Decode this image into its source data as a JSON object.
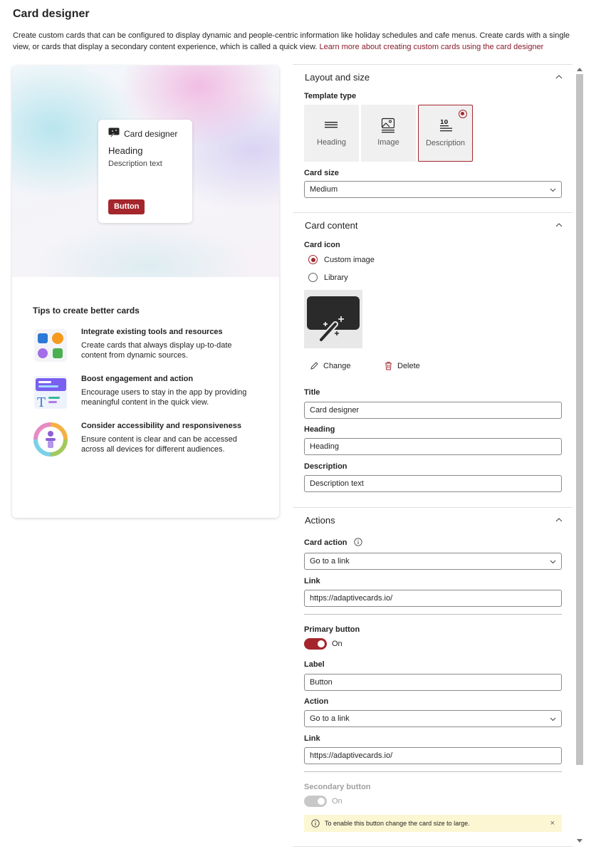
{
  "header": {
    "title": "Card designer",
    "description": "Create custom cards that can be configured to display dynamic and people-centric information like holiday schedules and cafe menus. Create cards with a single view, or cards that display a secondary content experience, which is called a quick view. ",
    "learn_more": "Learn more about creating custom cards using the card designer"
  },
  "preview": {
    "card_title": "Card designer",
    "heading": "Heading",
    "description": "Description text",
    "button": "Button"
  },
  "tips": {
    "title": "Tips to create better cards",
    "items": [
      {
        "title": "Integrate existing tools and resources",
        "text": "Create cards that always display up-to-date content from dynamic sources."
      },
      {
        "title": "Boost engagement and action",
        "text": "Encourage users to stay in the app by providing meaningful content in the quick view."
      },
      {
        "title": "Consider accessibility and responsiveness",
        "text": "Ensure content is clear and can be accessed across all devices for different audiences."
      }
    ]
  },
  "layout": {
    "section_title": "Layout and size",
    "template_type_label": "Template type",
    "templates": [
      "Heading",
      "Image",
      "Description"
    ],
    "selected_template": "Description",
    "card_size_label": "Card size",
    "card_size_value": "Medium"
  },
  "content": {
    "section_title": "Card content",
    "card_icon_label": "Card icon",
    "icon_options": [
      "Custom image",
      "Library"
    ],
    "selected_icon_option": "Custom image",
    "change_label": "Change",
    "delete_label": "Delete",
    "title_label": "Title",
    "title_value": "Card designer",
    "heading_label": "Heading",
    "heading_value": "Heading",
    "description_label": "Description",
    "description_value": "Description text"
  },
  "actions": {
    "section_title": "Actions",
    "card_action_label": "Card action",
    "card_action_value": "Go to a link",
    "link_label": "Link",
    "link_value": "https://adaptivecards.io/",
    "primary_button_label": "Primary button",
    "primary_button_state": "On",
    "label_label": "Label",
    "label_value": "Button",
    "action_label": "Action",
    "action_value": "Go to a link",
    "primary_link_label": "Link",
    "primary_link_value": "https://adaptivecards.io/",
    "secondary_button_label": "Secondary button",
    "secondary_button_state": "On",
    "info_message": "To enable this button change the card size to large.",
    "info_close": "×"
  },
  "colors": {
    "accent": "#a4262c",
    "link": "#8a1a2c",
    "info_bg": "#fdf6d3"
  }
}
